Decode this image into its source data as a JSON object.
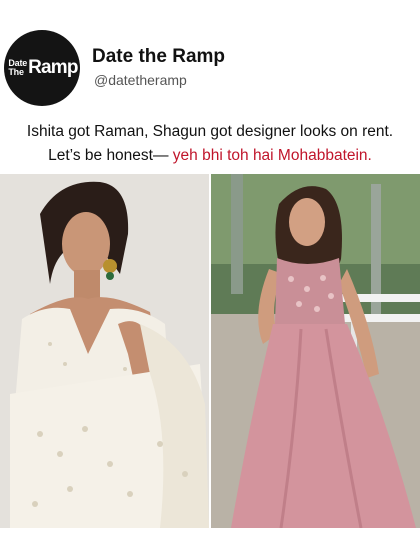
{
  "account": {
    "name": "Date the Ramp",
    "handle": "@datetheramp",
    "logo": {
      "line1": "Date",
      "line2": "The",
      "word": "Ramp"
    }
  },
  "caption": {
    "line1": "Ishita got Raman, Shagun got designer looks on rent.",
    "line2_prefix": "Let’s be honest— ",
    "line2_accent": "yeh bhi toh hai Mohabbatein."
  },
  "colors": {
    "accent": "#c0152b",
    "avatar_bg": "#141414"
  },
  "photos": [
    {
      "icon": "photo-woman-white-saree-icon"
    },
    {
      "icon": "photo-woman-pink-gown-icon"
    }
  ]
}
